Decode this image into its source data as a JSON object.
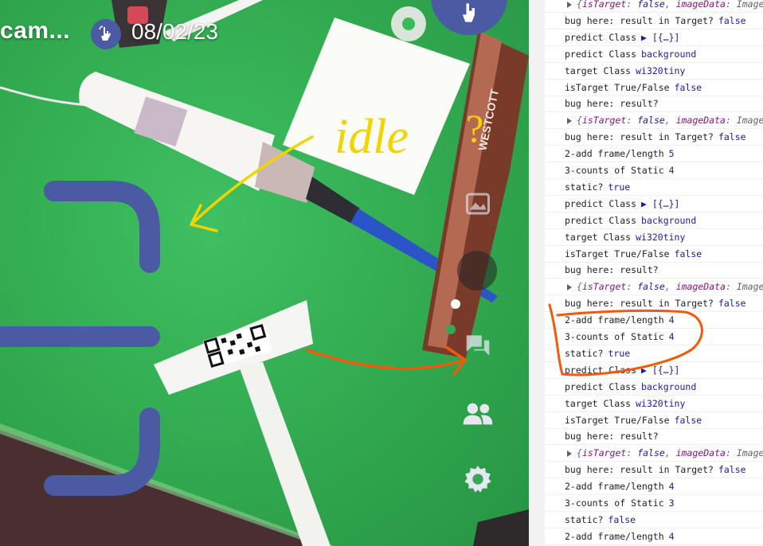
{
  "camera": {
    "title": "cam...",
    "date": "08/02/23",
    "icons": [
      "hand-pointer-icon",
      "touch-app-icon",
      "photo-icon",
      "chat-icon",
      "people-icon",
      "settings-icon"
    ]
  },
  "scene_labels": {
    "ruler_brand": "WESTCOTT"
  },
  "annotations": {
    "idle_text": "idle",
    "question_mark": "?"
  },
  "console": {
    "rows": [
      {
        "type": "obj",
        "text": "{isTarget: false, imageData: Image"
      },
      {
        "type": "log",
        "label": "bug here: result in Target?",
        "value": "false"
      },
      {
        "type": "log",
        "label": "predict Class",
        "value": "▶ [{…}]"
      },
      {
        "type": "log",
        "label": "predict Class",
        "value": "background"
      },
      {
        "type": "log",
        "label": "target Class",
        "value": "wi320tiny"
      },
      {
        "type": "log",
        "label": "isTarget True/False",
        "value": "false"
      },
      {
        "type": "log",
        "label": "bug here: result?",
        "value": ""
      },
      {
        "type": "obj",
        "text": "{isTarget: false, imageData: Image"
      },
      {
        "type": "log",
        "label": "bug here: result in Target?",
        "value": "false"
      },
      {
        "type": "log",
        "label": "2-add frame/length",
        "value": "5"
      },
      {
        "type": "log",
        "label": "3-counts of Static",
        "value": "4"
      },
      {
        "type": "log",
        "label": "static?",
        "value": "true"
      },
      {
        "type": "log",
        "label": "predict Class",
        "value": "▶ [{…}]"
      },
      {
        "type": "log",
        "label": "predict Class",
        "value": "background"
      },
      {
        "type": "log",
        "label": "target Class",
        "value": "wi320tiny"
      },
      {
        "type": "log",
        "label": "isTarget True/False",
        "value": "false"
      },
      {
        "type": "log",
        "label": "bug here: result?",
        "value": ""
      },
      {
        "type": "obj",
        "text": "{isTarget: false, imageData: Image"
      },
      {
        "type": "log",
        "label": "bug here: result in Target?",
        "value": "false"
      },
      {
        "type": "log",
        "label": "2-add frame/length",
        "value": "4"
      },
      {
        "type": "log",
        "label": "3-counts of Static",
        "value": "4"
      },
      {
        "type": "log",
        "label": "static?",
        "value": "true"
      },
      {
        "type": "log",
        "label": "predict Class",
        "value": "▶ [{…}]"
      },
      {
        "type": "log",
        "label": "predict Class",
        "value": "background"
      },
      {
        "type": "log",
        "label": "target Class",
        "value": "wi320tiny"
      },
      {
        "type": "log",
        "label": "isTarget True/False",
        "value": "false"
      },
      {
        "type": "log",
        "label": "bug here: result?",
        "value": ""
      },
      {
        "type": "obj",
        "text": "{isTarget: false, imageData: Image"
      },
      {
        "type": "log",
        "label": "bug here: result in Target?",
        "value": "false"
      },
      {
        "type": "log",
        "label": "2-add frame/length",
        "value": "4"
      },
      {
        "type": "log",
        "label": "3-counts of Static",
        "value": "3"
      },
      {
        "type": "log",
        "label": "static?",
        "value": "false"
      },
      {
        "type": "log",
        "label": "2-add frame/length",
        "value": "4"
      }
    ]
  },
  "colors": {
    "accent": "#4a5aa3",
    "annotation_yellow": "#f2d400",
    "annotation_orange": "#f25a0a",
    "console_value": "#1a1aa6"
  }
}
